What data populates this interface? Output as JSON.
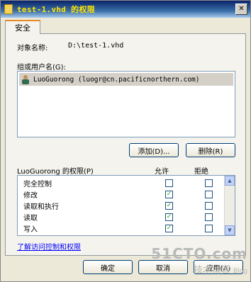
{
  "window": {
    "title": "test-1.vhd 的权限",
    "close_glyph": "✕"
  },
  "tabs": [
    {
      "label": "安全",
      "selected": true
    }
  ],
  "object": {
    "label": "对象名称:",
    "value": "D:\\test-1.vhd"
  },
  "groups": {
    "label": "组或用户名(G):",
    "users": [
      {
        "name": "LuoGuorong (luogr@cn.pacificnorthern.com)",
        "selected": true
      }
    ]
  },
  "buttons": {
    "add": "添加(D)...",
    "remove": "删除(R)",
    "ok": "确定",
    "cancel": "取消",
    "apply": "应用(A)"
  },
  "permissions": {
    "header": "LuoGuorong 的权限(P)",
    "allow_label": "允许",
    "deny_label": "拒绝",
    "rows": [
      {
        "name": "完全控制",
        "allow": false,
        "deny": false
      },
      {
        "name": "修改",
        "allow": true,
        "deny": false
      },
      {
        "name": "读取和执行",
        "allow": true,
        "deny": false
      },
      {
        "name": "读取",
        "allow": true,
        "deny": false
      },
      {
        "name": "写入",
        "allow": true,
        "deny": false
      }
    ]
  },
  "link": "了解访问控制和权限",
  "watermark": {
    "main": "51CTO.com",
    "sub": "技术博客",
    "blog": "Blog"
  },
  "colors": {
    "title_text": "#ffe600",
    "selection": "#d4d0c8",
    "check": "#21a121",
    "link": "#0000ff"
  }
}
